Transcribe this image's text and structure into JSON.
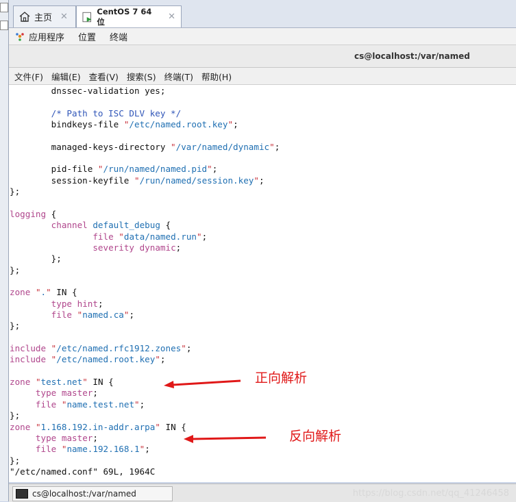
{
  "tabs": [
    {
      "label": "主页",
      "icon": "home-icon",
      "active": false
    },
    {
      "label": "CentOS 7 64 位",
      "icon": "vm-icon",
      "active": true
    }
  ],
  "app_menu": [
    "应用程序",
    "位置",
    "终端"
  ],
  "window_title": "cs@localhost:/var/named",
  "term_menu": [
    "文件(F)",
    "编辑(E)",
    "查看(V)",
    "搜索(S)",
    "终端(T)",
    "帮助(H)"
  ],
  "annotations": {
    "forward": "正向解析",
    "reverse": "反向解析"
  },
  "status_line": "\"/etc/named.conf\" 69L, 1964C",
  "taskbar_label": "cs@localhost:/var/named",
  "watermark": "https://blog.csdn.net/qq_41246458",
  "code_lines": [
    "        dnssec-validation yes;",
    "",
    "        /* Path to ISC DLV key */",
    "        bindkeys-file \"/etc/named.root.key\";",
    "",
    "        managed-keys-directory \"/var/named/dynamic\";",
    "",
    "        pid-file \"/run/named/named.pid\";",
    "        session-keyfile \"/run/named/session.key\";",
    "};",
    "",
    "logging {",
    "        channel default_debug {",
    "                file \"data/named.run\";",
    "                severity dynamic;",
    "        };",
    "};",
    "",
    "zone \".\" IN {",
    "        type hint;",
    "        file \"named.ca\";",
    "};",
    "",
    "include \"/etc/named.rfc1912.zones\";",
    "include \"/etc/named.root.key\";",
    "",
    "zone \"test.net\" IN {",
    "     type master;",
    "     file \"name.test.net\";",
    "};",
    "zone \"1.168.192.in-addr.arpa\" IN {",
    "     type master;",
    "     file \"name.192.168.1\";",
    "};"
  ]
}
